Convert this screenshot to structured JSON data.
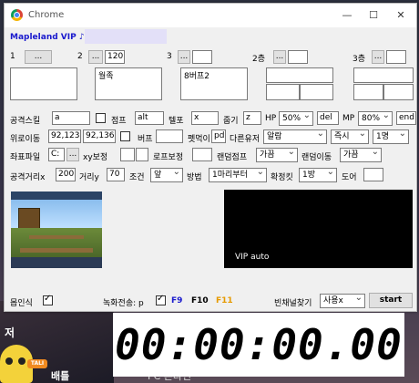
{
  "window": {
    "title": "Chrome",
    "minimize": "—",
    "maximize": "☐",
    "close": "✕"
  },
  "app": {
    "title": "Mapleland VIP ♪"
  },
  "slots": [
    {
      "num": "1",
      "btn": "...",
      "value": "",
      "text": ""
    },
    {
      "num": "2",
      "btn": "...",
      "value": "120",
      "text": "월족"
    },
    {
      "num": "3",
      "btn": "...",
      "value": "",
      "text": "8버프2"
    },
    {
      "num": "2층",
      "btn": "...",
      "value": "",
      "text": ""
    },
    {
      "num": "3층",
      "btn": "...",
      "value": "",
      "text": ""
    }
  ],
  "row1": {
    "attack_label": "공격스킬",
    "attack_value": "a",
    "jump_label": "점프",
    "jump_value": "alt",
    "tele_label": "텔포",
    "tele_value": "x",
    "pickup_label": "줍기",
    "pickup_value": "z",
    "hp_label": "HP",
    "hp_value": "50%",
    "hp_key": "del",
    "mp_label": "MP",
    "mp_value": "80%",
    "mp_key": "end"
  },
  "row2": {
    "pos_label": "위로이동",
    "pos_x": "92,123",
    "pos_y": "92,136",
    "buff_label": "버프",
    "buff_value": "",
    "pet_label": "펫먹이",
    "pet_value": "pdi",
    "other_user_label": "다른유저",
    "other_user_value": "알람",
    "instant_value": "즉시",
    "people_value": "1명"
  },
  "row3": {
    "coord_file_label": "좌표파일",
    "coord_file_value": "C:",
    "coord_btn": "...",
    "xy_label": "xy보정",
    "xy_value": "",
    "rope_label": "로프보정",
    "rope_value": "",
    "random_jump_label": "랜덤점프",
    "random_jump_value": "가끔",
    "random_move_label": "랜덤이동",
    "random_move_value": "가끔"
  },
  "row4": {
    "dist_x_label": "공격거리x",
    "dist_x_value": "200",
    "dist_y_label": "거리y",
    "dist_y_value": "70",
    "cond_label": "조건",
    "cond_value": "앞",
    "method_label": "방법",
    "method_value": "1마리부터",
    "confirm_label": "확정킷",
    "confirm_value": "1방",
    "door_label": "도어",
    "door_value": ""
  },
  "game_thumbnail_caption": "",
  "video": {
    "label": "VIP auto"
  },
  "footer": {
    "recognize_label": "몹인식",
    "record_label": "녹화전송: p",
    "f9": "F9",
    "f10": "F10",
    "f11": "F11",
    "channel_label": "빈채널찾기",
    "channel_value": "사용x",
    "start_label": "start",
    "colors": {
      "f9": "#1a1acd",
      "f10": "#000000",
      "f11": "#e69a00"
    }
  },
  "timer": {
    "value": "00:00:00.00"
  },
  "desktop": {
    "text1": "저",
    "text2": "배틀",
    "text3": "PC 온라인",
    "badge": "TALI"
  }
}
